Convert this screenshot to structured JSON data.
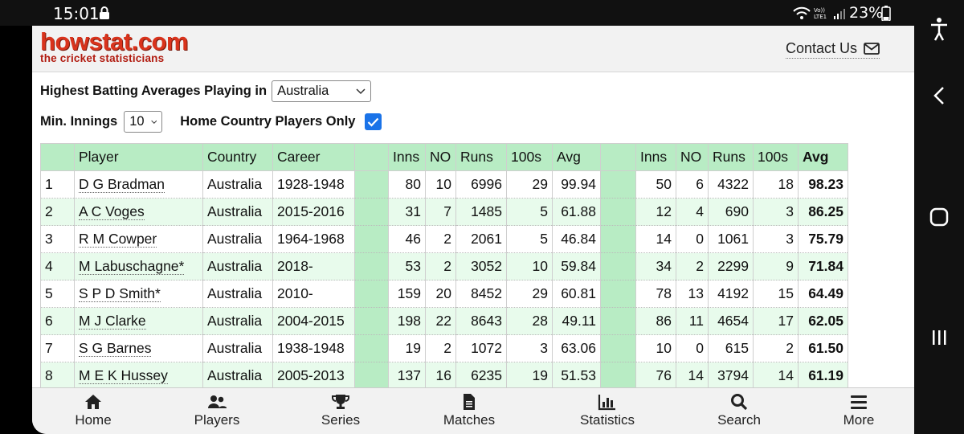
{
  "status": {
    "time": "15:01",
    "battery": "23%"
  },
  "header": {
    "logo_main": "howstat.com",
    "logo_sub": "the cricket statisticians",
    "contact": "Contact Us"
  },
  "filters": {
    "label": "Highest Batting Averages Playing in",
    "country": "Australia",
    "min_innings_label": "Min. Innings",
    "min_innings": "10",
    "home_only_label": "Home Country Players Only",
    "home_only_checked": true
  },
  "table": {
    "headers": [
      "Player",
      "Country",
      "Career",
      "Inns",
      "NO",
      "Runs",
      "100s",
      "Avg",
      "Inns",
      "NO",
      "Runs",
      "100s",
      "Avg"
    ],
    "rows": [
      [
        "1",
        "D G Bradman",
        "Australia",
        "1928-1948",
        "80",
        "10",
        "6996",
        "29",
        "99.94",
        "50",
        "6",
        "4322",
        "18",
        "98.23"
      ],
      [
        "2",
        "A C Voges",
        "Australia",
        "2015-2016",
        "31",
        "7",
        "1485",
        "5",
        "61.88",
        "12",
        "4",
        "690",
        "3",
        "86.25"
      ],
      [
        "3",
        "R M Cowper",
        "Australia",
        "1964-1968",
        "46",
        "2",
        "2061",
        "5",
        "46.84",
        "14",
        "0",
        "1061",
        "3",
        "75.79"
      ],
      [
        "4",
        "M Labuschagne*",
        "Australia",
        "2018-",
        "53",
        "2",
        "3052",
        "10",
        "59.84",
        "34",
        "2",
        "2299",
        "9",
        "71.84"
      ],
      [
        "5",
        "S P D Smith*",
        "Australia",
        "2010-",
        "159",
        "20",
        "8452",
        "29",
        "60.81",
        "78",
        "13",
        "4192",
        "15",
        "64.49"
      ],
      [
        "6",
        "M J Clarke",
        "Australia",
        "2004-2015",
        "198",
        "22",
        "8643",
        "28",
        "49.11",
        "86",
        "11",
        "4654",
        "17",
        "62.05"
      ],
      [
        "7",
        "S G Barnes",
        "Australia",
        "1938-1948",
        "19",
        "2",
        "1072",
        "3",
        "63.06",
        "10",
        "0",
        "615",
        "2",
        "61.50"
      ],
      [
        "8",
        "M E K Hussey",
        "Australia",
        "2005-2013",
        "137",
        "16",
        "6235",
        "19",
        "51.53",
        "76",
        "14",
        "3794",
        "14",
        "61.19"
      ]
    ]
  },
  "bottom_nav": [
    "Home",
    "Players",
    "Series",
    "Matches",
    "Statistics",
    "Search",
    "More"
  ],
  "colors": {
    "header_green": "#b8ecc4",
    "alt_row": "#e8fbec",
    "logo_red": "#d9331c",
    "check_blue": "#1a73e8"
  }
}
